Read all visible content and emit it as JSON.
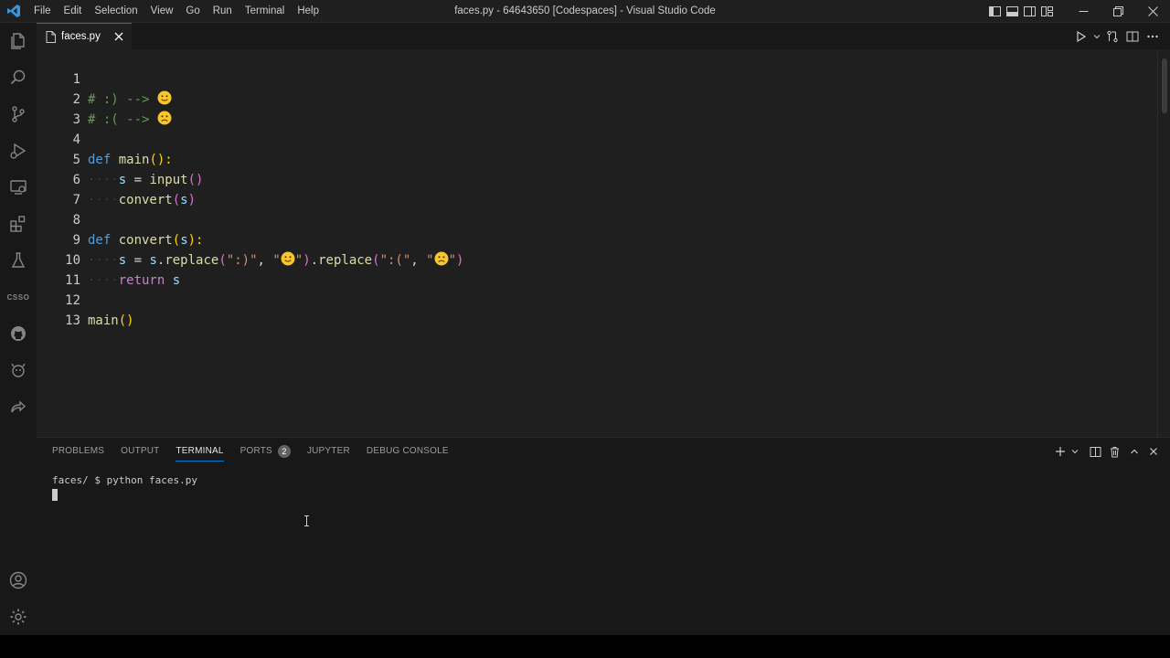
{
  "window": {
    "title": "faces.py - 64643650 [Codespaces] - Visual Studio Code"
  },
  "menu": [
    "File",
    "Edit",
    "Selection",
    "View",
    "Go",
    "Run",
    "Terminal",
    "Help"
  ],
  "activity_bar": [
    "explorer-icon",
    "search-icon",
    "source-control-icon",
    "run-debug-icon",
    "remote-explorer-icon",
    "extensions-icon",
    "testing-icon",
    "css-icon",
    "github-icon",
    "codespaces-icon",
    "live-share-icon",
    "accounts-icon",
    "manage-icon"
  ],
  "css_icon_text": "CSSO",
  "tab": {
    "label": "faces.py"
  },
  "editor": {
    "line_numbers": [
      "1",
      "2",
      "3",
      "4",
      "5",
      "6",
      "7",
      "8",
      "9",
      "10",
      "11",
      "12",
      "13"
    ],
    "code": {
      "l1_comment": "# :) --> ",
      "l2_comment": "# :( --> ",
      "l4_def": "def",
      "l4_fn": "main",
      "l4_rest": "():",
      "l5_s": "s",
      "l5_eq": " = ",
      "l5_fn": "input",
      "l5_paren": "()",
      "l6_fn": "convert",
      "l6_open": "(",
      "l6_arg": "s",
      "l6_close": ")",
      "l8_def": "def",
      "l8_fn": "convert",
      "l8_open": "(",
      "l8_arg": "s",
      "l8_close": "):",
      "l9_s": "s",
      "l9_eq": " = ",
      "l9_obj": "s",
      "l9_dot": ".",
      "l9_m1": "replace",
      "l9_o1": "(",
      "l9_str1": "\":)\"",
      "l9_comma1": ", ",
      "l9_q1": "\"",
      "l9_q2": "\"",
      "l9_c1": ")",
      "l9_dot2": ".",
      "l9_m2": "replace",
      "l9_o2": "(",
      "l9_str2": "\":(\"",
      "l9_comma2": ", ",
      "l9_q3": "\"",
      "l9_q4": "\"",
      "l9_c2": ")",
      "l10_kw": "return",
      "l10_var": " s",
      "l12_fn": "main",
      "l12_paren": "()",
      "indent": "····"
    }
  },
  "panel": {
    "tabs": [
      "PROBLEMS",
      "OUTPUT",
      "TERMINAL",
      "PORTS",
      "JUPYTER",
      "DEBUG CONSOLE"
    ],
    "ports_badge": "2",
    "terminal_line": "faces/ $ python faces.py"
  },
  "colors": {
    "accent": "#0078d4",
    "editor_bg": "#1f1f1f",
    "keyword": "#569cd6",
    "function": "#dcdcaa",
    "comment": "#6a9955",
    "string": "#ce9178"
  }
}
